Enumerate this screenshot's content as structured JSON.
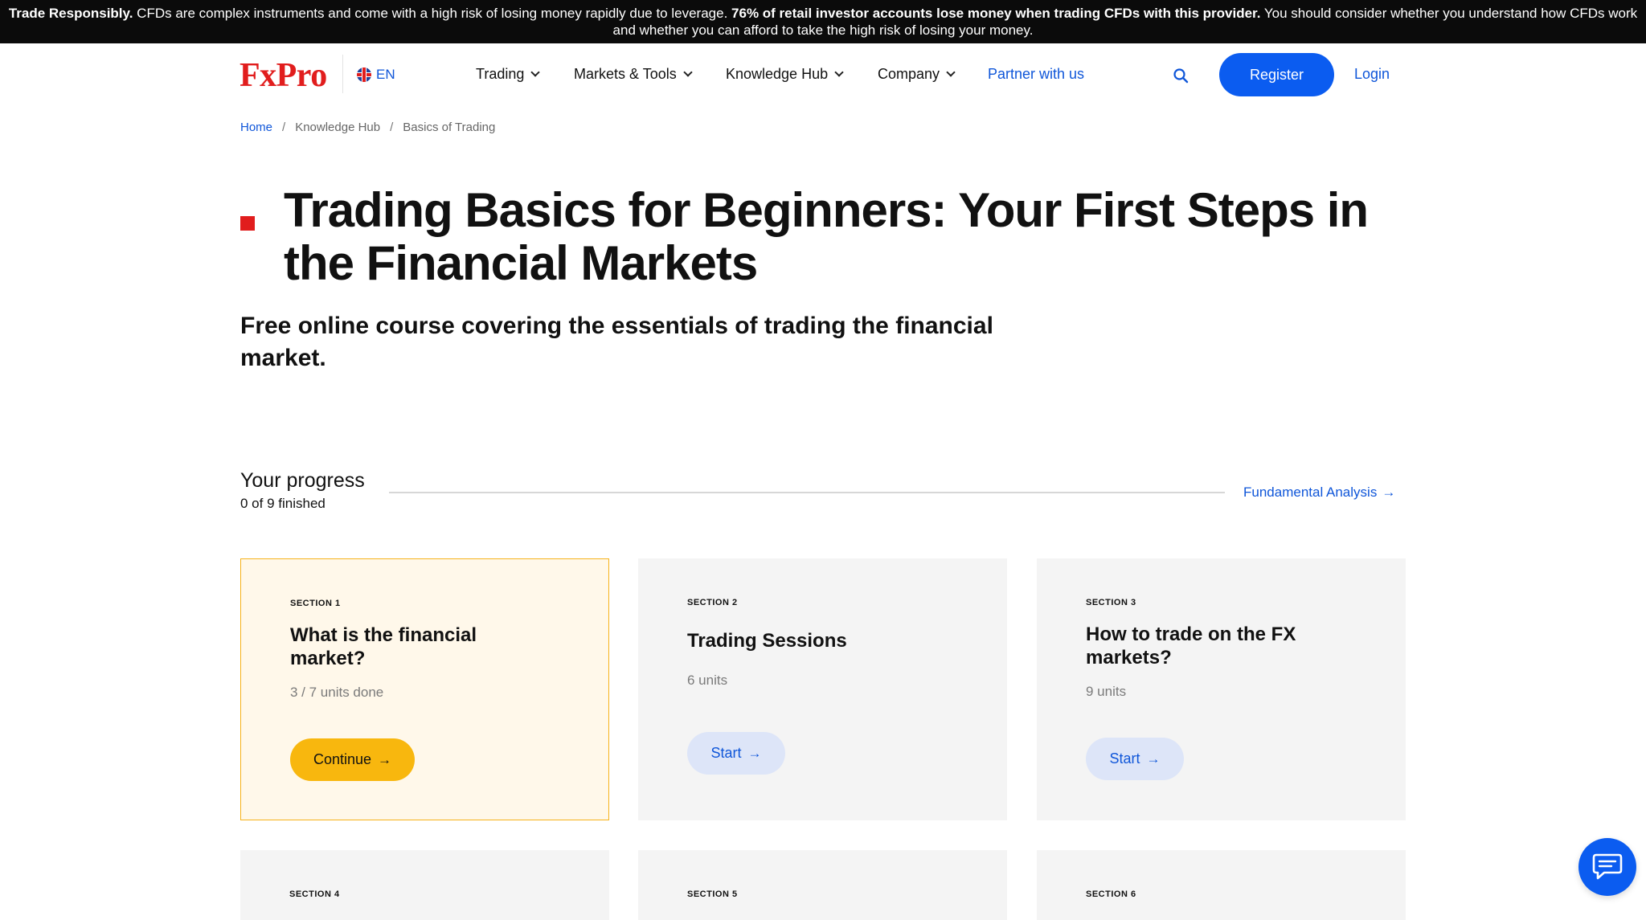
{
  "risk_banner": {
    "bold_1": "Trade Responsibly.",
    "text_1": " CFDs are complex instruments and come with a high risk of losing money rapidly due to leverage. ",
    "bold_2": "76% of retail investor accounts lose money when trading CFDs with this provider.",
    "text_2": " You should consider whether you understand how CFDs work and whether you can afford to take the high risk of losing your money."
  },
  "header": {
    "logo": "FxPro",
    "language": "EN",
    "nav": [
      {
        "label": "Trading"
      },
      {
        "label": "Markets & Tools"
      },
      {
        "label": "Knowledge Hub"
      },
      {
        "label": "Company"
      }
    ],
    "partner": "Partner with us",
    "register": "Register",
    "login": "Login"
  },
  "breadcrumb": {
    "home": "Home",
    "sep": "/",
    "hub": "Knowledge Hub",
    "current": "Basics of Trading"
  },
  "page": {
    "title": "Trading Basics for Beginners: Your First Steps in the Financial Markets",
    "subtitle": "Free online course covering the essentials of trading the financial market."
  },
  "progress": {
    "title": "Your progress",
    "count": "0 of 9 finished",
    "fraction": 0,
    "next": "Fundamental Analysis"
  },
  "cards": [
    {
      "section": "SECTION 1",
      "title": "What is the financial market?",
      "units": "3 / 7 units done",
      "button": "Continue"
    },
    {
      "section": "SECTION 2",
      "title": "Trading Sessions",
      "units": "6 units",
      "button": "Start"
    },
    {
      "section": "SECTION 3",
      "title": "How to trade on the FX markets?",
      "units": "9 units",
      "button": "Start"
    },
    {
      "section": "SECTION 4"
    },
    {
      "section": "SECTION 5"
    },
    {
      "section": "SECTION 6"
    }
  ],
  "colors": {
    "accent_red": "#e11d1d",
    "primary_blue": "#0b5cf0",
    "continue_yellow": "#f8b70e"
  }
}
